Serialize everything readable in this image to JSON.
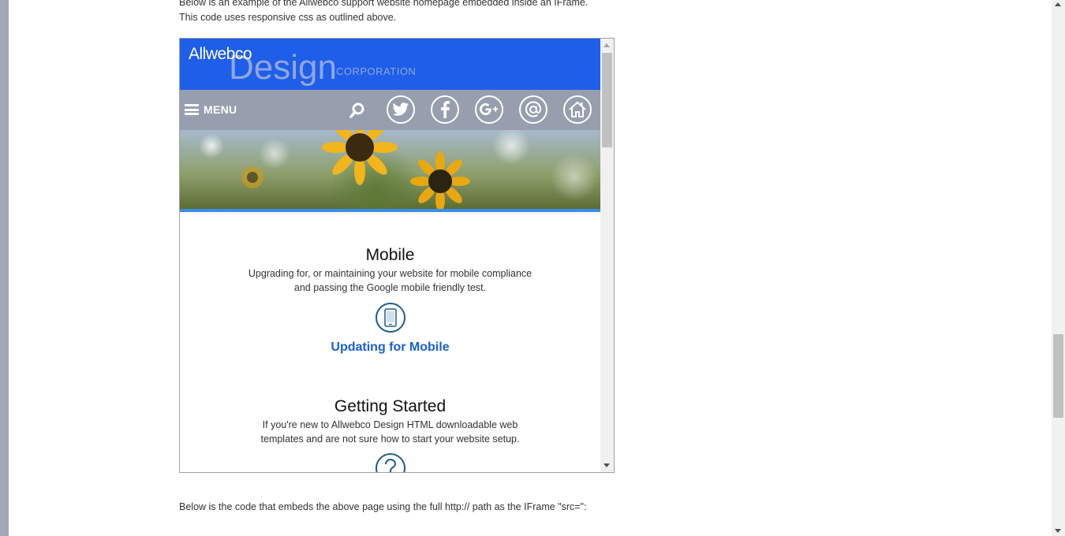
{
  "page": {
    "intro_line1": "Below is an example of the Allwebco support website homepage embedded inside an IFrame.",
    "intro_line2": "This code uses responsive css as outlined above.",
    "bottom_text": "Below is the code that embeds the above page using the full http:// path as the IFrame \"src=\":"
  },
  "site": {
    "logo": {
      "brand": "Allwebco",
      "design": "Design",
      "corp": "CORPORATION"
    },
    "nav": {
      "menu_label": "MENU",
      "icons": [
        "search-icon",
        "twitter-icon",
        "facebook-icon",
        "google-plus-icon",
        "email-icon",
        "home-icon"
      ]
    },
    "sections": [
      {
        "title": "Mobile",
        "text_line1": "Upgrading for, or maintaining your website for mobile compliance",
        "text_line2": "and passing the Google mobile friendly test.",
        "icon": "mobile-phone-icon",
        "link": "Updating for Mobile"
      },
      {
        "title": "Getting Started",
        "text_line1": "If you're new to Allwebco Design HTML downloadable web",
        "text_line2": "templates and are not sure how to start your website setup.",
        "icon": "question-icon"
      }
    ]
  },
  "colors": {
    "header_blue": "#1e5ee8",
    "nav_gray": "#979fae",
    "link_blue": "#1a5fd6",
    "icon_blue": "#1d5d8c",
    "banner_line": "#3a8ee6"
  }
}
